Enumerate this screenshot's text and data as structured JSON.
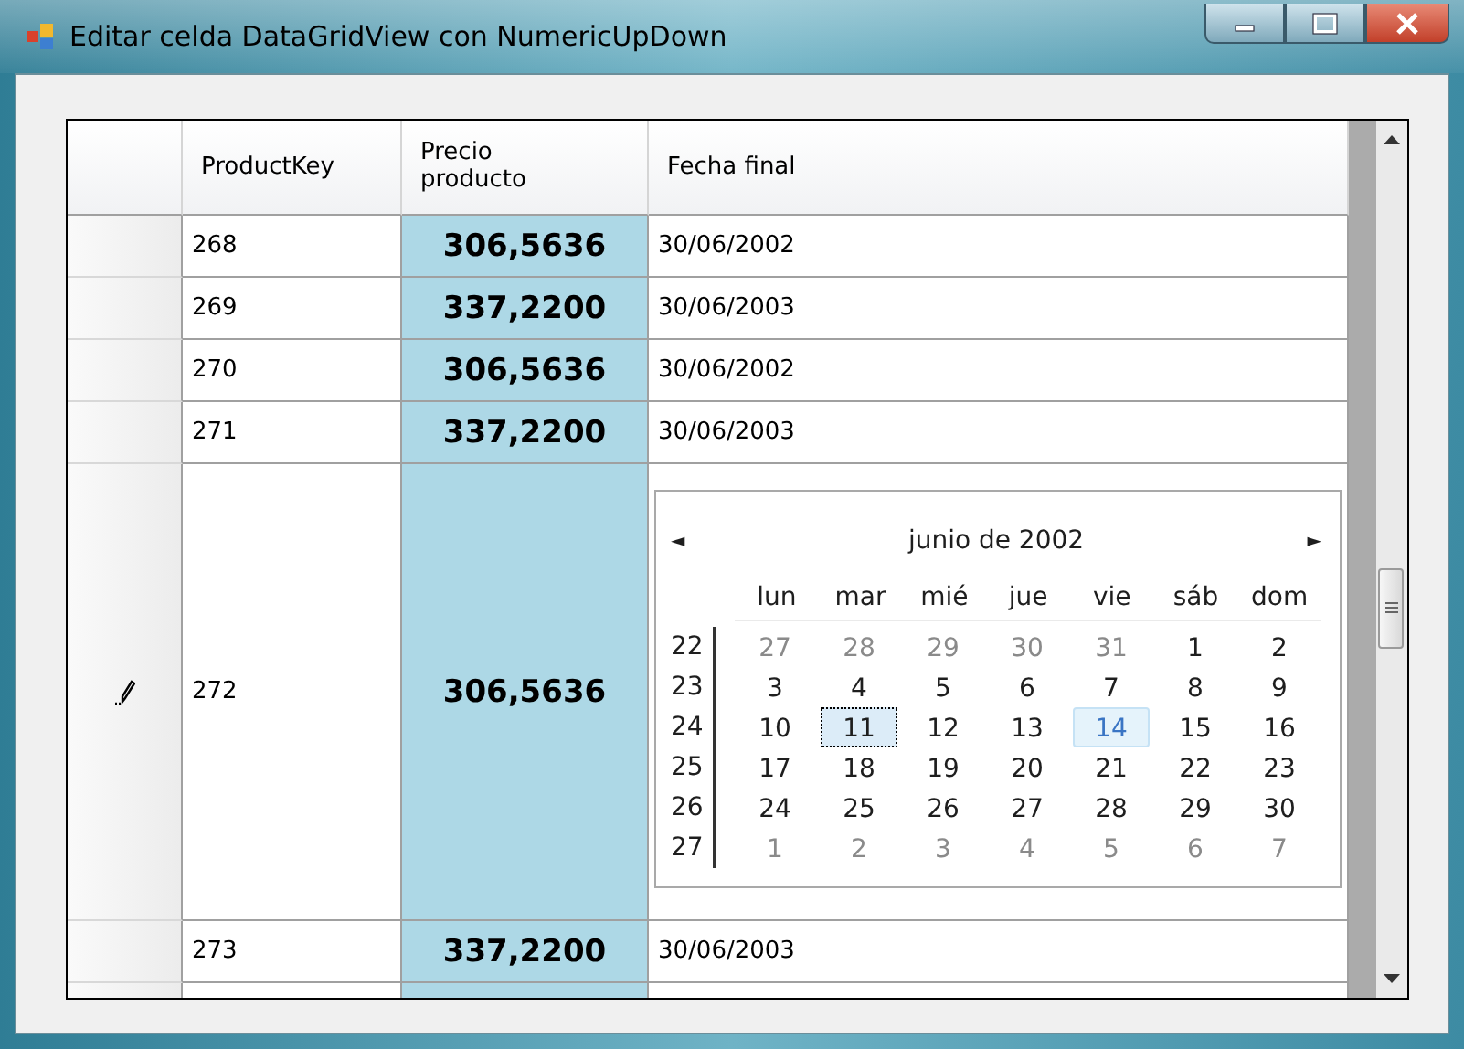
{
  "window": {
    "title": "Editar celda DataGridView con NumericUpDown"
  },
  "grid": {
    "columns": [
      "ProductKey",
      "Precio producto",
      "Fecha final"
    ],
    "rows": [
      {
        "product_key": "268",
        "price": "306,5636",
        "date": "30/06/2002",
        "editing": false
      },
      {
        "product_key": "269",
        "price": "337,2200",
        "date": "30/06/2003",
        "editing": false
      },
      {
        "product_key": "270",
        "price": "306,5636",
        "date": "30/06/2002",
        "editing": false
      },
      {
        "product_key": "271",
        "price": "337,2200",
        "date": "30/06/2003",
        "editing": false
      },
      {
        "product_key": "272",
        "price": "306,5636",
        "editing": true,
        "calendar": {
          "month": "junio de 2002",
          "prev": "◄",
          "next": "►",
          "weekdays": [
            "lun",
            "mar",
            "mié",
            "jue",
            "vie",
            "sáb",
            "dom"
          ],
          "weeks": [
            {
              "week": "22",
              "days": [
                {
                  "d": "27",
                  "muted": true,
                  "selected": false,
                  "today": false
                },
                {
                  "d": "28",
                  "muted": true,
                  "selected": false,
                  "today": false
                },
                {
                  "d": "29",
                  "muted": true,
                  "selected": false,
                  "today": false
                },
                {
                  "d": "30",
                  "muted": true,
                  "selected": false,
                  "today": false
                },
                {
                  "d": "31",
                  "muted": true,
                  "selected": false,
                  "today": false
                },
                {
                  "d": "1",
                  "muted": false,
                  "selected": false,
                  "today": false
                },
                {
                  "d": "2",
                  "muted": false,
                  "selected": false,
                  "today": false
                }
              ]
            },
            {
              "week": "23",
              "days": [
                {
                  "d": "3",
                  "muted": false,
                  "selected": false,
                  "today": false
                },
                {
                  "d": "4",
                  "muted": false,
                  "selected": false,
                  "today": false
                },
                {
                  "d": "5",
                  "muted": false,
                  "selected": false,
                  "today": false
                },
                {
                  "d": "6",
                  "muted": false,
                  "selected": false,
                  "today": false
                },
                {
                  "d": "7",
                  "muted": false,
                  "selected": false,
                  "today": false
                },
                {
                  "d": "8",
                  "muted": false,
                  "selected": false,
                  "today": false
                },
                {
                  "d": "9",
                  "muted": false,
                  "selected": false,
                  "today": false
                }
              ]
            },
            {
              "week": "24",
              "days": [
                {
                  "d": "10",
                  "muted": false,
                  "selected": false,
                  "today": false
                },
                {
                  "d": "11",
                  "muted": false,
                  "selected": true,
                  "today": false
                },
                {
                  "d": "12",
                  "muted": false,
                  "selected": false,
                  "today": false
                },
                {
                  "d": "13",
                  "muted": false,
                  "selected": false,
                  "today": false
                },
                {
                  "d": "14",
                  "muted": false,
                  "selected": false,
                  "today": true
                },
                {
                  "d": "15",
                  "muted": false,
                  "selected": false,
                  "today": false
                },
                {
                  "d": "16",
                  "muted": false,
                  "selected": false,
                  "today": false
                }
              ]
            },
            {
              "week": "25",
              "days": [
                {
                  "d": "17",
                  "muted": false,
                  "selected": false,
                  "today": false
                },
                {
                  "d": "18",
                  "muted": false,
                  "selected": false,
                  "today": false
                },
                {
                  "d": "19",
                  "muted": false,
                  "selected": false,
                  "today": false
                },
                {
                  "d": "20",
                  "muted": false,
                  "selected": false,
                  "today": false
                },
                {
                  "d": "21",
                  "muted": false,
                  "selected": false,
                  "today": false
                },
                {
                  "d": "22",
                  "muted": false,
                  "selected": false,
                  "today": false
                },
                {
                  "d": "23",
                  "muted": false,
                  "selected": false,
                  "today": false
                }
              ]
            },
            {
              "week": "26",
              "days": [
                {
                  "d": "24",
                  "muted": false,
                  "selected": false,
                  "today": false
                },
                {
                  "d": "25",
                  "muted": false,
                  "selected": false,
                  "today": false
                },
                {
                  "d": "26",
                  "muted": false,
                  "selected": false,
                  "today": false
                },
                {
                  "d": "27",
                  "muted": false,
                  "selected": false,
                  "today": false
                },
                {
                  "d": "28",
                  "muted": false,
                  "selected": false,
                  "today": false
                },
                {
                  "d": "29",
                  "muted": false,
                  "selected": false,
                  "today": false
                },
                {
                  "d": "30",
                  "muted": false,
                  "selected": false,
                  "today": false
                }
              ]
            },
            {
              "week": "27",
              "days": [
                {
                  "d": "1",
                  "muted": true,
                  "selected": false,
                  "today": false
                },
                {
                  "d": "2",
                  "muted": true,
                  "selected": false,
                  "today": false
                },
                {
                  "d": "3",
                  "muted": true,
                  "selected": false,
                  "today": false
                },
                {
                  "d": "4",
                  "muted": true,
                  "selected": false,
                  "today": false
                },
                {
                  "d": "5",
                  "muted": true,
                  "selected": false,
                  "today": false
                },
                {
                  "d": "6",
                  "muted": true,
                  "selected": false,
                  "today": false
                },
                {
                  "d": "7",
                  "muted": true,
                  "selected": false,
                  "today": false
                }
              ]
            }
          ]
        }
      },
      {
        "product_key": "273",
        "price": "337,2200",
        "date": "30/06/2003",
        "editing": false
      }
    ]
  }
}
